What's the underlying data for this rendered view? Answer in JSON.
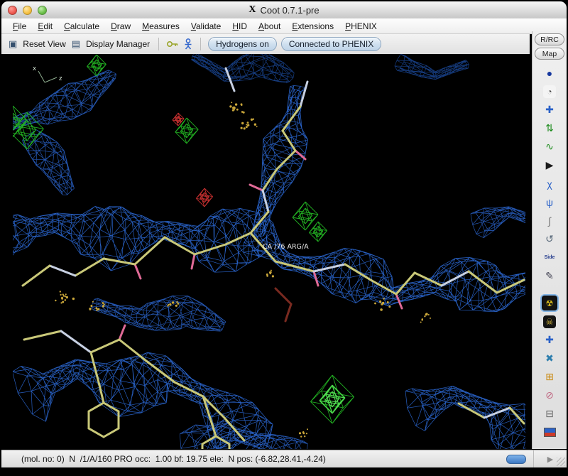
{
  "window": {
    "title": "Coot 0.7.1-pre",
    "x11_glyph": "X"
  },
  "menubar": {
    "items": [
      "File",
      "Edit",
      "Calculate",
      "Draw",
      "Measures",
      "Validate",
      "HID",
      "About",
      "Extensions",
      "PHENIX"
    ]
  },
  "toolbar": {
    "reset_icon_glyph": "▣",
    "reset_view": "Reset View",
    "dm_icon_glyph": "▤",
    "display_manager": "Display Manager",
    "hydrogens": "Hydrogens on",
    "phenix": "Connected to PHENIX"
  },
  "right_panel": {
    "rrc": "R/RC",
    "map": "Map"
  },
  "canvas": {
    "residue_label": "CA /76 ARG/A",
    "axis_x": "x",
    "axis_z": "z",
    "colors": {
      "density_map": "#2e6fe0",
      "diff_map_positive": "#23b523",
      "diff_map_negative": "#cc3030",
      "carbon_bonds": "#c9c878",
      "highlight_bonds": "#c7d0e2",
      "waters": "#c9a63a"
    }
  },
  "side_toolbar": {
    "icons": [
      {
        "name": "map-sphere-icon",
        "glyph": "●",
        "color": "#15379e"
      },
      {
        "name": "clock-icon",
        "glyph": "◔",
        "color": "#444",
        "bg": "#f4f4f4"
      },
      {
        "name": "translate-icon",
        "glyph": "✚",
        "color": "#2b62c8"
      },
      {
        "name": "rotate-axes-icon",
        "glyph": "⇅",
        "color": "#1d8c1d"
      },
      {
        "name": "torsion-icon",
        "glyph": "∿",
        "color": "#1d8c1d"
      },
      {
        "name": "play-icon",
        "glyph": "▶",
        "color": "#1a1a1a"
      },
      {
        "name": "chi-angles-icon",
        "glyph": "χ",
        "color": "#2b62c8"
      },
      {
        "name": "phi-psi-icon",
        "glyph": "ψ",
        "color": "#2b62c8"
      },
      {
        "name": "hook-icon",
        "glyph": "∫",
        "color": "#777777"
      },
      {
        "name": "refresh-view-icon",
        "glyph": "↺",
        "color": "#556677"
      },
      {
        "name": "side-chain-icon",
        "label": "Side"
      },
      {
        "name": "pencil-icon",
        "glyph": "✎",
        "color": "#444455"
      },
      {
        "name": "radiation-icon",
        "glyph": "☢",
        "color": "#e3c51f",
        "bg": "#141414",
        "active": true,
        "gap": true
      },
      {
        "name": "skull-icon",
        "glyph": "☠",
        "color": "#d8b93c",
        "bg": "#141414"
      },
      {
        "name": "add-atom-icon",
        "glyph": "✚",
        "color": "#2b62c8"
      },
      {
        "name": "cross-bonds-icon",
        "glyph": "✖",
        "color": "#2f7fae"
      },
      {
        "name": "add-residue-icon",
        "glyph": "⊞",
        "color": "#c98a12"
      },
      {
        "name": "eraser-icon",
        "glyph": "⊘",
        "color": "#c06a84"
      },
      {
        "name": "trash-icon",
        "glyph": "⊟",
        "color": "#666666"
      },
      {
        "name": "palette-icon",
        "swatch": true,
        "colors": [
          "#2b62c8",
          "#cc3b2a"
        ]
      }
    ]
  },
  "statusbar": {
    "text": "(mol. no: 0)  N  /1/A/160 PRO occ:  1.00 bf: 19.75 ele:  N pos: (-6.82,28.41,-4.24)",
    "expander_glyph": "▶"
  }
}
